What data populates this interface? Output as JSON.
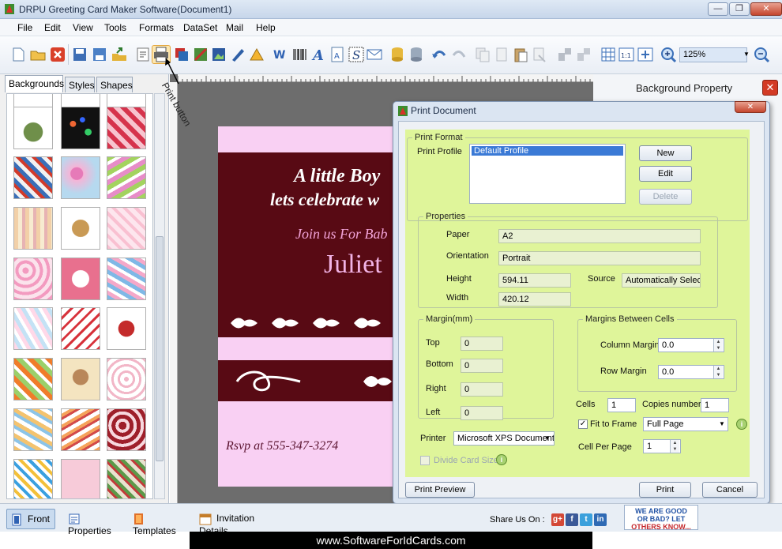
{
  "window": {
    "title": "DRPU Greeting Card Maker Software(Document1)",
    "min_label": "—",
    "max_label": "❐",
    "close_label": "✕"
  },
  "menu": [
    "File",
    "Edit",
    "View",
    "Tools",
    "Formats",
    "DataSet",
    "Mail",
    "Help"
  ],
  "toolbar": {
    "zoom_value": "125%",
    "icons": [
      "new-icon",
      "open-icon",
      "close-doc-icon",
      "save-icon",
      "save-as-icon",
      "export-icon",
      "properties-icon",
      "print-icon",
      "print-preview-icon",
      "crop-icon",
      "image-icon",
      "pen-icon",
      "shape-icon",
      "barcode-icon",
      "text-icon",
      "word-art-icon",
      "signature-icon",
      "mail-icon",
      "database-icon",
      "database-2-icon",
      "undo-icon",
      "redo-icon",
      "copy-icon",
      "paste-icon",
      "clipboard-icon",
      "cut-icon",
      "align-icon",
      "align-2-icon",
      "grid-icon",
      "actual-size-icon",
      "fit-icon",
      "zoom-in-icon",
      "zoom-out-icon"
    ]
  },
  "left_panel": {
    "tabs": [
      "Backgrounds",
      "Styles",
      "Shapes"
    ],
    "active_tab": "Backgrounds"
  },
  "annotation": {
    "print_button": "Print button"
  },
  "card": {
    "line1": "A little Boy",
    "line2": "lets celebrate w",
    "line3": "Join us For Bab",
    "name": "Juliet",
    "rsvp": "Rsvp at 555-347-3274"
  },
  "right_panel": {
    "title": "Background Property",
    "close_label": "✕"
  },
  "dialog": {
    "title": "Print Document",
    "close_label": "✕",
    "print_format_legend": "Print Format",
    "print_profile_label": "Print Profile",
    "profiles": [
      "Default Profile"
    ],
    "new_label": "New",
    "edit_label": "Edit",
    "delete_label": "Delete",
    "properties_legend": "Properties",
    "paper_label": "Paper",
    "paper_value": "A2",
    "orientation_label": "Orientation",
    "orientation_value": "Portrait",
    "height_label": "Height",
    "height_value": "594.11",
    "width_label": "Width",
    "width_value": "420.12",
    "source_label": "Source",
    "source_value": "Automatically Select",
    "margin_legend": "Margin(mm)",
    "top_label": "Top",
    "top_value": "0",
    "bottom_label": "Bottom",
    "bottom_value": "0",
    "right_label": "Right",
    "right_value": "0",
    "left_label": "Left",
    "left_value": "0",
    "cells_margin_legend": "Margins Between Cells",
    "column_margin_label": "Column Margin",
    "column_margin_value": "0.0",
    "row_margin_label": "Row Margin",
    "row_margin_value": "0.0",
    "cells_label": "Cells",
    "cells_value": "1",
    "copies_label": "Copies number",
    "copies_value": "1",
    "fit_to_frame_label": "Fit to Frame",
    "fit_to_frame_checked": true,
    "fit_mode_value": "Full Page",
    "cell_per_page_label": "Cell Per Page",
    "cell_per_page_value": "1",
    "printer_label": "Printer",
    "printer_value": "Microsoft XPS Document",
    "divide_label": "Divide Card Size",
    "print_preview_label": "Print Preview",
    "print_label": "Print",
    "cancel_label": "Cancel",
    "info_label": "i",
    "check_mark": "✓",
    "dropdown_arrow": "▼",
    "spin_up": "▲",
    "spin_down": "▼"
  },
  "bottom_tabs": [
    "Front",
    "Properties",
    "Templates",
    "Invitation Details"
  ],
  "share_label": "Share Us On :",
  "social": [
    "g+",
    "f",
    "t",
    "in"
  ],
  "badge": {
    "line1": "WE ARE GOOD",
    "line2": "OR BAD? LET",
    "line3": "OTHERS KNOW..."
  },
  "footer": "www.SoftwareForIdCards.com",
  "colors": {
    "card_pink": "#f9d0f3",
    "card_maroon": "#580a14",
    "dialog_green": "#dff59a",
    "canvas_gray": "#6d6d6d"
  }
}
